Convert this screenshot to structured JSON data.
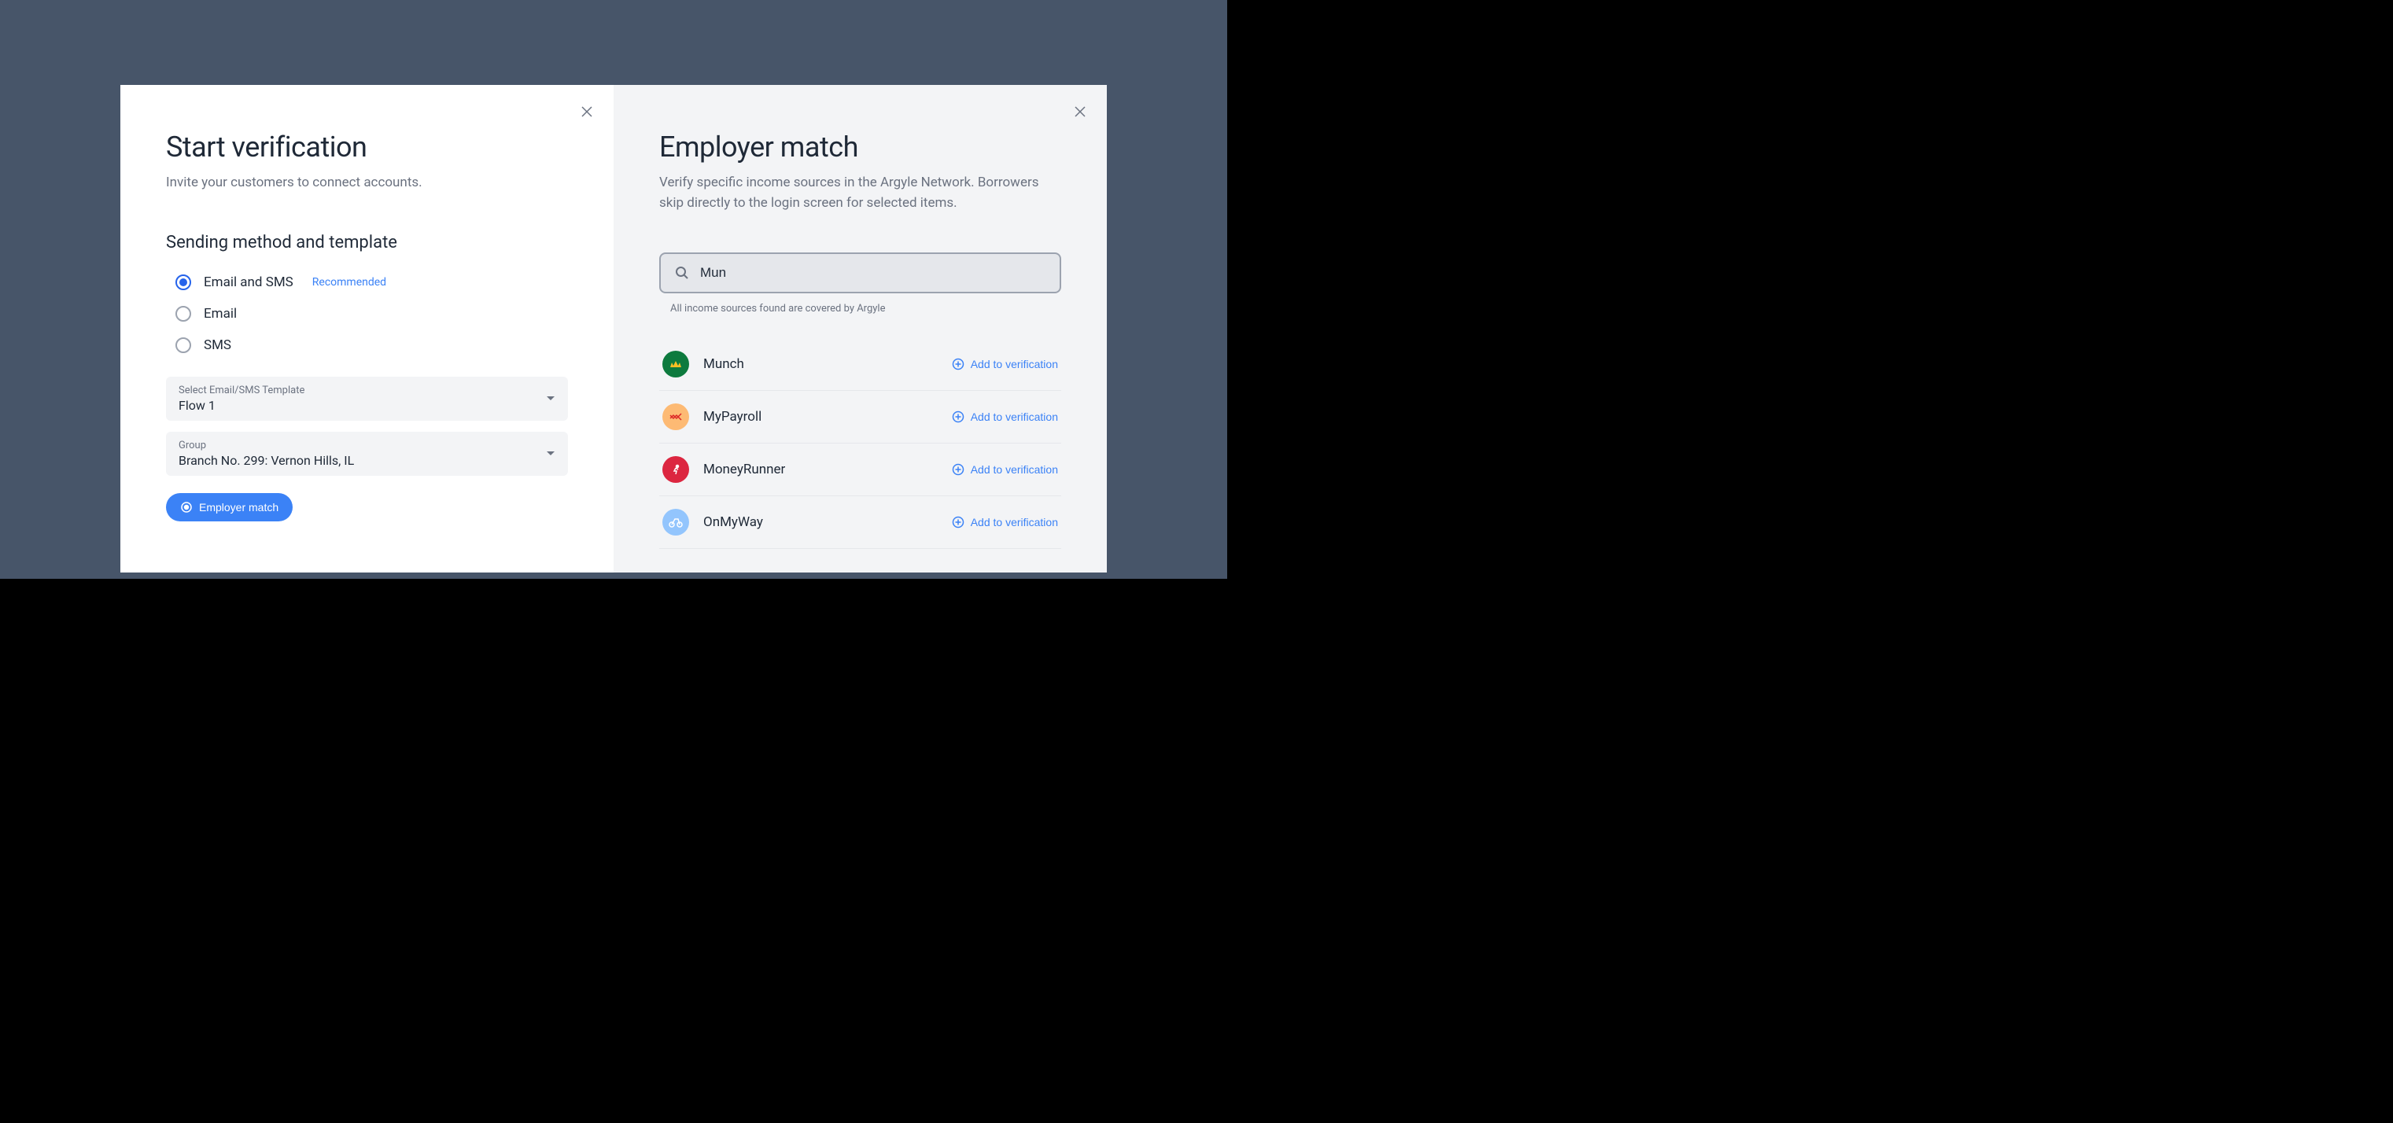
{
  "left": {
    "title": "Start verification",
    "subtitle": "Invite your customers to connect accounts.",
    "section_heading": "Sending method and template",
    "radio_options": [
      {
        "label": "Email and SMS",
        "recommended": "Recommended",
        "selected": true
      },
      {
        "label": "Email",
        "selected": false
      },
      {
        "label": "SMS",
        "selected": false
      }
    ],
    "template_select": {
      "label": "Select Email/SMS Template",
      "value": "Flow 1"
    },
    "group_select": {
      "label": "Group",
      "value": "Branch No. 299: Vernon Hills, IL"
    },
    "employer_match_button": "Employer match"
  },
  "right": {
    "title": "Employer match",
    "subtitle": "Verify specific income sources in the Argyle Network. Borrowers skip directly to the login screen for selected items.",
    "search_value": "Mun",
    "search_note": "All income sources found are covered by Argyle",
    "add_label": "Add to verification",
    "results": [
      {
        "name": "Munch",
        "icon_class": "icon-munch"
      },
      {
        "name": "MyPayroll",
        "icon_class": "icon-mypayroll"
      },
      {
        "name": "MoneyRunner",
        "icon_class": "icon-moneyrunner"
      },
      {
        "name": "OnMyWay",
        "icon_class": "icon-onmyway"
      }
    ]
  }
}
